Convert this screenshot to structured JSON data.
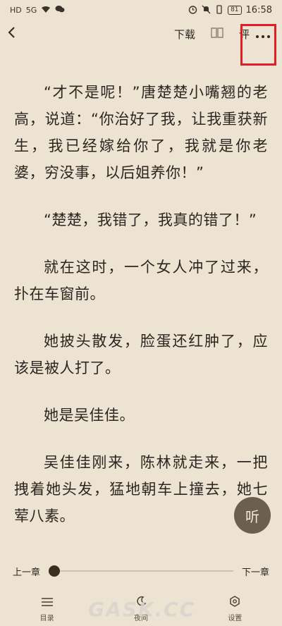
{
  "status_bar": {
    "left_icons": [
      "HD",
      "5G",
      "wifi",
      "wechat"
    ],
    "battery": "81",
    "time": "16:58"
  },
  "top_bar": {
    "back_icon": "back-arrow-icon",
    "download_label": "下载",
    "book_icon": "book-icon",
    "comment_label": "评",
    "more_icon": "more-dots-icon"
  },
  "highlight_color": "#e01e24",
  "reader": {
    "paragraphs": [
      "“才不是呢！”唐楚楚小嘴翘的老高，说道：“你治好了我，让我重获新生，我已经嫁给你了，我就是你老婆，穷没事，以后姐养你！”",
      "“楚楚，我错了，我真的错了！”",
      "就在这时，一个女人冲了过来，扑在车窗前。",
      "她披头散发，脸蛋还红肿了，应该是被人打了。",
      "她是吴佳佳。",
      "吴佳佳刚来，陈林就走来，一把拽着她头发，猛地朝车上撞去，她七荤八素。"
    ]
  },
  "listen_label": "听",
  "progress": {
    "prev_label": "上一章",
    "next_label": "下一章",
    "value": 0
  },
  "bottom_tabs": [
    {
      "icon": "list-icon",
      "label": "目录"
    },
    {
      "icon": "moon-icon",
      "label": "夜间"
    },
    {
      "icon": "settings-icon",
      "label": "设置"
    }
  ],
  "watermark": "GASK.CC"
}
